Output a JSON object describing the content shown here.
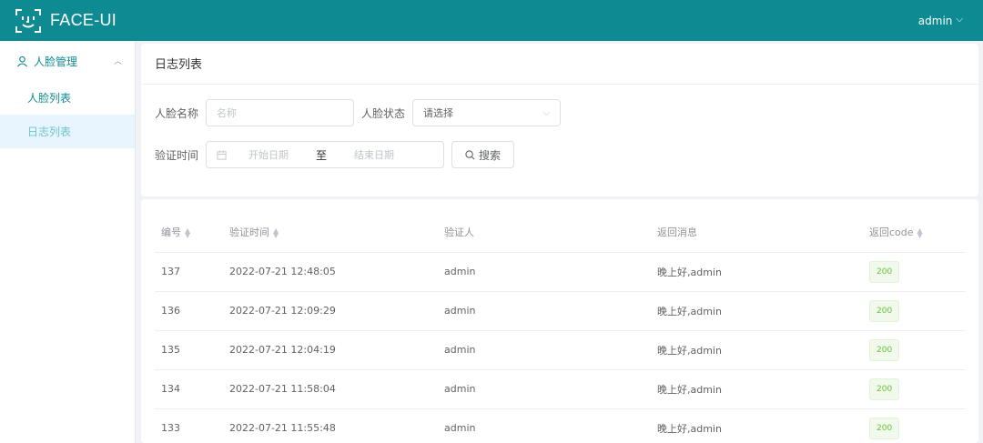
{
  "header": {
    "brand": "FACE-UI",
    "user": "admin"
  },
  "sidebar": {
    "group": "人脸管理",
    "items": [
      {
        "label": "人脸列表"
      },
      {
        "label": "日志列表"
      }
    ]
  },
  "filters": {
    "title": "日志列表",
    "name_label": "人脸名称",
    "name_placeholder": "名称",
    "status_label": "人脸状态",
    "status_value": "请选择",
    "time_label": "验证时间",
    "start_placeholder": "开始日期",
    "range_separator": "至",
    "end_placeholder": "结束日期",
    "search_label": "搜索"
  },
  "table": {
    "columns": [
      "编号",
      "验证时间",
      "验证人",
      "返回消息",
      "返回code"
    ],
    "rows": [
      {
        "id": "137",
        "time": "2022-07-21 12:48:05",
        "user": "admin",
        "msg": "晚上好,admin",
        "code": "200"
      },
      {
        "id": "136",
        "time": "2022-07-21 12:09:29",
        "user": "admin",
        "msg": "晚上好,admin",
        "code": "200"
      },
      {
        "id": "135",
        "time": "2022-07-21 12:04:19",
        "user": "admin",
        "msg": "晚上好,admin",
        "code": "200"
      },
      {
        "id": "134",
        "time": "2022-07-21 11:58:04",
        "user": "admin",
        "msg": "晚上好,admin",
        "code": "200"
      },
      {
        "id": "133",
        "time": "2022-07-21 11:55:48",
        "user": "admin",
        "msg": "晚上好,admin",
        "code": "200"
      }
    ]
  },
  "colors": {
    "primary": "#0e8a92",
    "success": "#67c23a",
    "active_bg": "#e8f5ff"
  }
}
